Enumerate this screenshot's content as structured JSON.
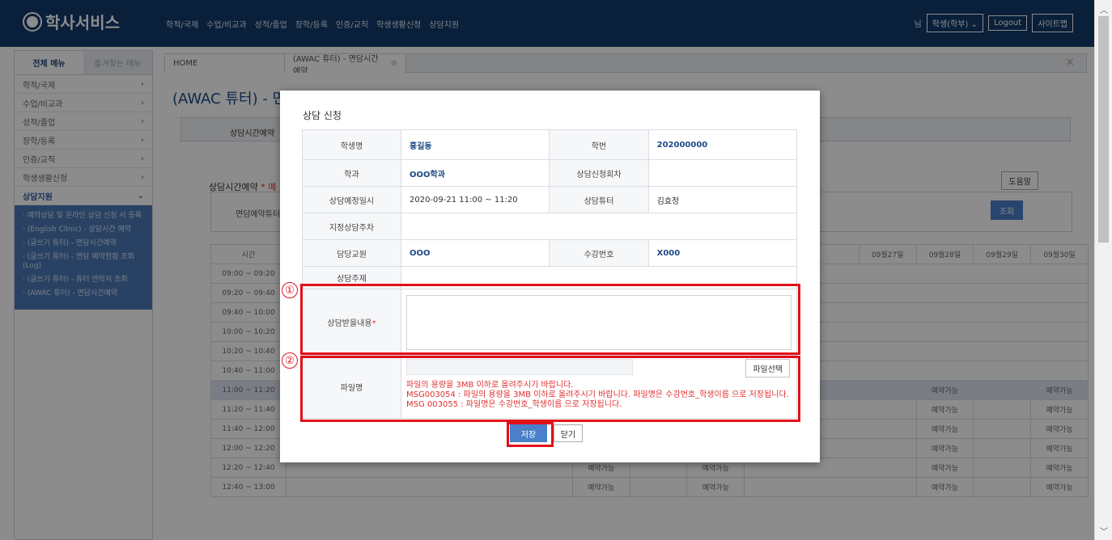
{
  "header": {
    "logo_text": "학사서비스",
    "nav": [
      "학적/국제",
      "수업/비교과",
      "성적/졸업",
      "장학/등록",
      "인증/교직",
      "학생생활신청",
      "상담지원"
    ],
    "user_suffix": "님",
    "role_select": "학생(학부)",
    "logout": "Logout",
    "sitemap": "사이트맵"
  },
  "sidebar": {
    "tab_all": "전체 메뉴",
    "tab_fav": "즐겨찾는 메뉴",
    "items": [
      {
        "label": "학적/국제"
      },
      {
        "label": "수업/비교과"
      },
      {
        "label": "성적/졸업"
      },
      {
        "label": "장학/등록"
      },
      {
        "label": "인증/교직"
      },
      {
        "label": "학생생활신청"
      },
      {
        "label": "상담지원"
      }
    ],
    "subitems": [
      "· 예약상담 및 온라인 상담 신청 서 등록",
      "· (English Clinic) - 상담시간 예약",
      "· (글쓰기 튜터) - 면담시간예약",
      "· (글쓰기 튜터) - 면담 예약현황 조회(Log)",
      "· (글쓰기 튜터) - 튜터 연락처 조회",
      "· (AWAC 튜터) - 면담시간예약"
    ]
  },
  "tabs": {
    "home": "HOME",
    "current": "(AWAC 튜터) - 면담시간예약",
    "close_icon": "×"
  },
  "page": {
    "title": "(AWAC 튜터) - 면담",
    "tab_label": "상담시간예약",
    "section_label": "상담시간예약",
    "section_note": "* 예",
    "help_button": "도움말",
    "filter_label": "면담예약튜터료",
    "search_button": "조회",
    "grid_header_time": "시간",
    "grid_header_days": [
      "09월27일",
      "09월28일",
      "09월29일",
      "09월30일"
    ],
    "time_slots": [
      "09:00 ~ 09:20",
      "09:20 ~ 09:40",
      "09:40 ~ 10:00",
      "10:00 ~ 10:20",
      "10:20 ~ 10:40",
      "10:40 ~ 11:00",
      "11:00 ~ 11:20",
      "11:20 ~ 11:40",
      "11:40 ~ 12:00",
      "12:00 ~ 12:20",
      "12:20 ~ 12:40",
      "12:40 ~ 13:00"
    ],
    "available": "예약가능"
  },
  "modal": {
    "title": "상담 신청",
    "rows": {
      "student_name_label": "학생명",
      "student_name_value": "홍길동",
      "student_id_label": "학번",
      "student_id_value": "202000000",
      "dept_label": "학과",
      "dept_value": "OOO학과",
      "session_label": "상담신청회차",
      "session_value": "",
      "datetime_label": "상담예정일시",
      "datetime_value": "2020-09-21 11:00 ~ 11:20",
      "tutor_label": "상담튜터",
      "tutor_value": "김효정",
      "week_label": "지정상담주차",
      "week_value": "",
      "prof_label": "담당교원",
      "prof_value": "OOO",
      "course_label": "수강번호",
      "course_value": "X000",
      "topic_label": "상담주제",
      "topic_value": "",
      "content_label": "상담받을내용",
      "required_mark": "*",
      "file_label": "파일명",
      "file_button": "파일선택",
      "file_msg_1": "파일의 용량을 3MB 이하로 올려주시기 바랍니다.",
      "file_msg_2": "MSG003054 : 파일의 용량을 3MB 이하로 올려주시기 바랍니다. 파일명은 수강번호_학생이름 으로 저장됩니다. MSG 003055 : 파일명은 수강번호_학생이름 으로 저장됩니다."
    },
    "save_button": "저장",
    "close_button": "닫기"
  },
  "annotations": {
    "marker_1": "①",
    "marker_2": "②"
  },
  "colors": {
    "header_bg": "#123a6b",
    "accent_blue": "#4a7fc9",
    "annotation_red": "#e2101a"
  }
}
